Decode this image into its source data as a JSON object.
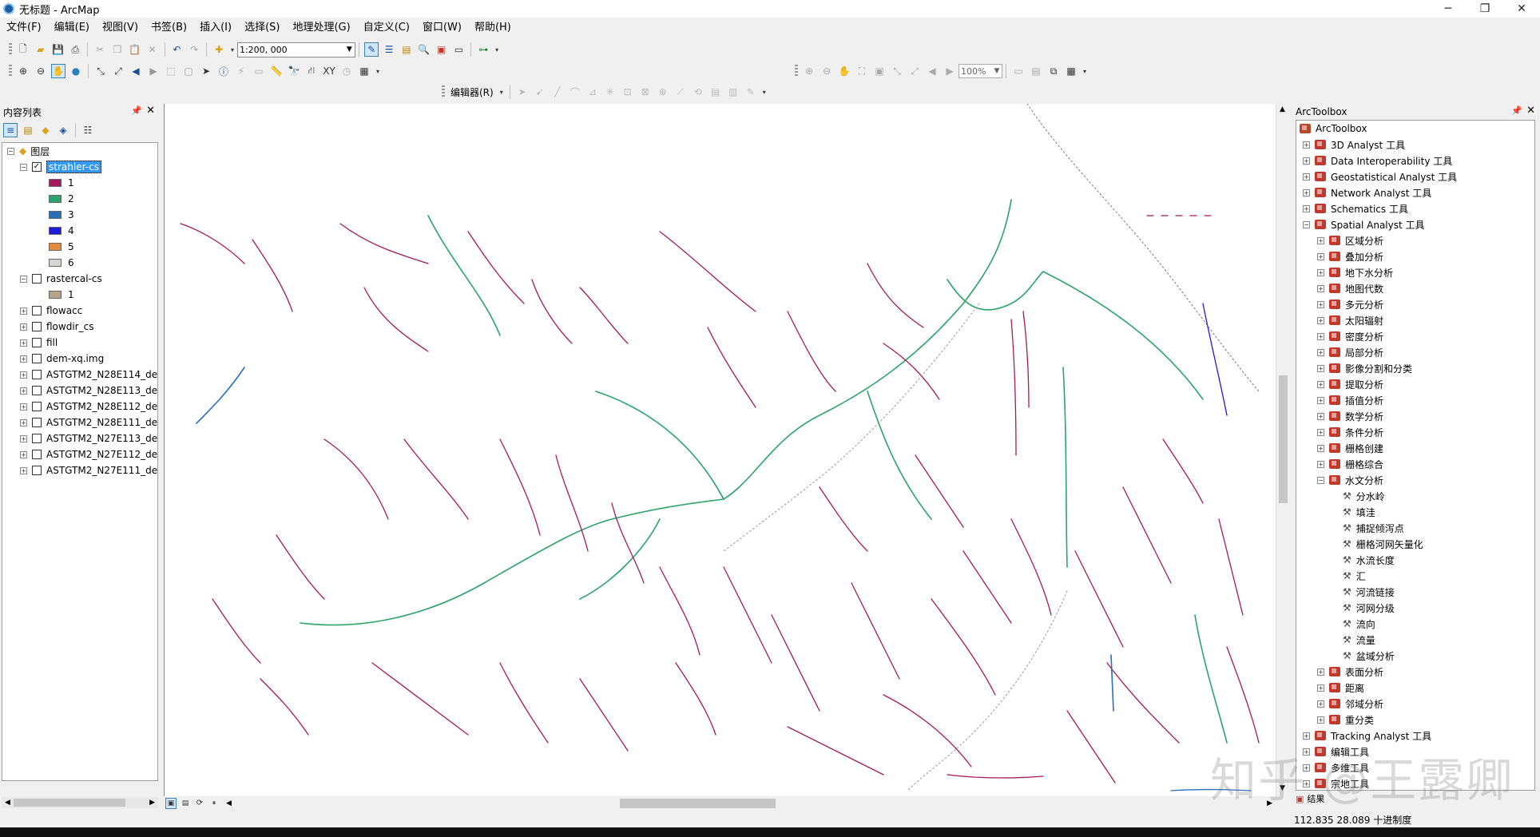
{
  "window": {
    "title": "无标题 - ArcMap",
    "controls": [
      "─",
      "❐",
      "✕"
    ]
  },
  "menu": [
    "文件(F)",
    "编辑(E)",
    "视图(V)",
    "书签(B)",
    "插入(I)",
    "选择(S)",
    "地理处理(G)",
    "自定义(C)",
    "窗口(W)",
    "帮助(H)"
  ],
  "toolbar": {
    "scale": "1:200, 000",
    "zoom_percent": "100%",
    "editor_label": "编辑器(R)"
  },
  "toc": {
    "title": "内容列表",
    "layers_root": "图层",
    "strahler": {
      "name": "strahler-cs",
      "checked": true,
      "classes": [
        {
          "label": "1",
          "color": "#a3195b"
        },
        {
          "label": "2",
          "color": "#2ba36b"
        },
        {
          "label": "3",
          "color": "#2a6fbd"
        },
        {
          "label": "4",
          "color": "#1c1cd4"
        },
        {
          "label": "5",
          "color": "#e88a3c"
        },
        {
          "label": "6",
          "color": "#d6d6cc"
        }
      ]
    },
    "rastercal": {
      "name": "rastercal-cs",
      "class_label": "1",
      "class_color": "#b8a48a"
    },
    "layers": [
      "flowacc",
      "flowdir_cs",
      "fill",
      "dem-xq.img",
      "ASTGTM2_N28E114_de",
      "ASTGTM2_N28E113_de",
      "ASTGTM2_N28E112_de",
      "ASTGTM2_N28E111_de",
      "ASTGTM2_N27E113_de",
      "ASTGTM2_N27E112_de",
      "ASTGTM2_N27E111_de"
    ]
  },
  "arctoolbox": {
    "title": "ArcToolbox",
    "root": "ArcToolbox",
    "toolboxes_before": [
      "3D Analyst 工具",
      "Data Interoperability 工具",
      "Geostatistical Analyst 工具",
      "Network Analyst 工具",
      "Schematics 工具"
    ],
    "spatial_analyst": "Spatial Analyst 工具",
    "sa_toolsets_before": [
      "区域分析",
      "叠加分析",
      "地下水分析",
      "地图代数",
      "多元分析",
      "太阳辐射",
      "密度分析",
      "局部分析",
      "影像分割和分类",
      "提取分析",
      "插值分析",
      "数学分析",
      "条件分析",
      "栅格创建",
      "栅格综合"
    ],
    "hydrology": "水文分析",
    "hydrology_tools": [
      "分水岭",
      "填洼",
      "捕捉倾泻点",
      "栅格河网矢量化",
      "水流长度",
      "汇",
      "河流链接",
      "河网分级",
      "流向",
      "流量",
      "盆域分析"
    ],
    "sa_toolsets_after": [
      "表面分析",
      "距离",
      "邻域分析",
      "重分类"
    ],
    "toolboxes_after": [
      "Tracking Analyst 工具",
      "编辑工具",
      "多维工具",
      "宗地工具"
    ],
    "bottom_tab": "结果"
  },
  "status": {
    "coords": "112.835  28.089 十进制度"
  },
  "watermark": "知乎 @王露卿"
}
